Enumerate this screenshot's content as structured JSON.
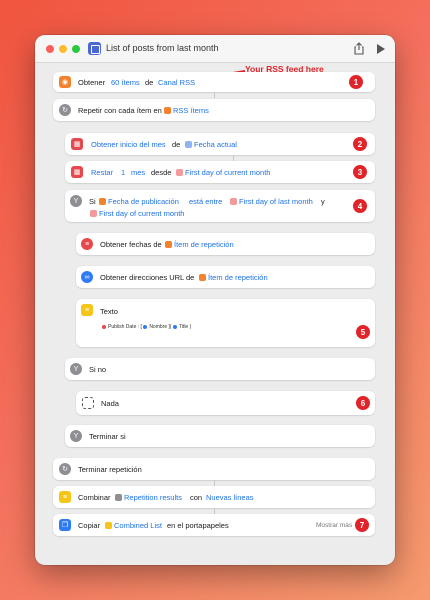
{
  "window": {
    "title": "List of posts from last month"
  },
  "annotation": {
    "callout": "Your RSS feed here"
  },
  "colors": {
    "accent": "#1f72e6",
    "badge": "#e0242a",
    "orange": "#f2822b",
    "gray": "#8e8e93",
    "red": "#e5484d",
    "yellow": "#f5c518",
    "blue": "#2f7bf5"
  },
  "actions": {
    "a1": {
      "verb": "Obtener",
      "count": "60 ítems",
      "prep": "de",
      "source": "Canal RSS",
      "badge": "1"
    },
    "a2": {
      "verb": "Repetir con cada ítem en",
      "var": "RSS ítems"
    },
    "a3": {
      "verb": "Obtener inicio del mes",
      "prep": "de",
      "var": "Fecha actual",
      "badge": "2"
    },
    "a4": {
      "verb": "Restar",
      "num": "1",
      "unit": "mes",
      "prep": "desde",
      "var": "First day of current month",
      "badge": "3"
    },
    "a5": {
      "verb": "Si",
      "var1": "Fecha de publicación",
      "cond": "está entre",
      "var2": "First day of last month",
      "conj": "y",
      "var3": "First day of current month",
      "badge": "4"
    },
    "a6": {
      "verb": "Obtener fechas de",
      "var": "Ítem de repetición"
    },
    "a7": {
      "verb": "Obtener direcciones URL de",
      "var": "Ítem de repetición"
    },
    "a8": {
      "verb": "Texto",
      "t1": "Publish Date",
      "t2": ": [",
      "t3": "Nombre",
      "t4": "](",
      "t5": "Title",
      "t6": ")",
      "badge": "5"
    },
    "a9": {
      "verb": "Si no"
    },
    "a10": {
      "verb": "Nada",
      "badge": "6"
    },
    "a11": {
      "verb": "Terminar si"
    },
    "a12": {
      "verb": "Terminar repetición"
    },
    "a13": {
      "verb": "Combinar",
      "var": "Repetition results",
      "prep": "con",
      "sep": "Nuevas líneas"
    },
    "a14": {
      "verb": "Copiar",
      "var": "Combined List",
      "suffix": "en el portapapeles",
      "more": "Mostrar más",
      "badge": "7"
    }
  }
}
